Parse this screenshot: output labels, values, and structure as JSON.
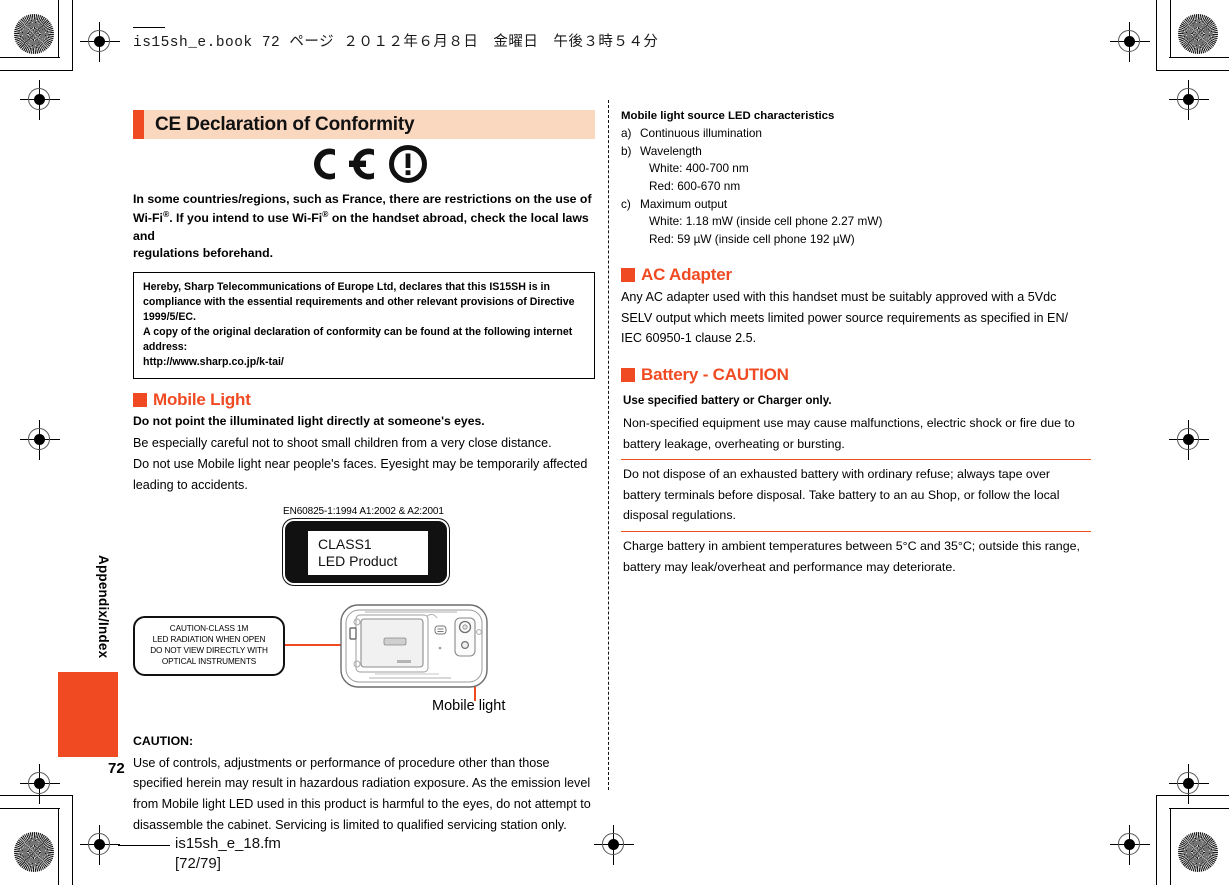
{
  "runhead": "is15sh_e.book  72 ページ  ２０１２年６月８日　金曜日　午後３時５４分",
  "sidebar": {
    "tab_label": "Appendix/Index",
    "page_number": "72",
    "accent_color": "#f04a23"
  },
  "footer": {
    "file_name": "is15sh_e_18.fm",
    "page_range": "[72/79]"
  },
  "left": {
    "banner_title": "CE Declaration of Conformity",
    "ce_marks": [
      "CE",
      "alert-exclamation"
    ],
    "wifi_note_line1": "In some countries/regions, such as France, there are restrictions on the use of",
    "wifi_note_line2_a": "Wi-Fi",
    "wifi_note_line2_sup": "®",
    "wifi_note_line2_b": ". If you intend to use Wi-Fi",
    "wifi_note_line2_sup2": "®",
    "wifi_note_line2_c": " on the handset abroad, check the local laws and",
    "wifi_note_line3": "regulations beforehand.",
    "declaration_box": [
      "Hereby, Sharp Telecommunications of Europe Ltd, declares that this IS15SH is in",
      "compliance with the essential requirements and other relevant provisions of Directive",
      "1999/5/EC.",
      "A copy of the original declaration of conformity can be found at the following internet",
      "address:",
      "http://www.sharp.co.jp/k-tai/"
    ],
    "mobile_light_heading": "Mobile Light",
    "mobile_light_lead": "Do not point the illuminated light directly at someone's eyes.",
    "mobile_light_p1": "Be especially careful not to shoot small children from a very close distance.",
    "mobile_light_p2": "Do not use Mobile light near people's faces. Eyesight may be temporarily affected",
    "mobile_light_p3": "leading to accidents.",
    "figure": {
      "en_standard": "EN60825-1:1994  A1:2002 & A2:2001",
      "class_plate_line1": "CLASS1",
      "class_plate_line2": "LED Product",
      "caution_plate": [
        "CAUTION-CLASS 1M",
        "LED RADIATION WHEN OPEN",
        "DO NOT VIEW DIRECTLY WITH",
        "OPTICAL INSTRUMENTS"
      ],
      "callout_label": "Mobile light"
    },
    "caution_title": "CAUTION:",
    "caution_p1": "Use of controls, adjustments or performance of procedure other than those",
    "caution_p2": "specified herein may result in hazardous radiation exposure. As the emission level",
    "caution_p3": "from Mobile light LED used in this product is harmful to the eyes, do not attempt to",
    "caution_p4": "disassemble the cabinet. Servicing is limited to qualified servicing station only."
  },
  "right": {
    "led_char_title": "Mobile light source LED characteristics",
    "led_items": [
      {
        "marker": "a)",
        "text": "Continuous illumination",
        "sub": []
      },
      {
        "marker": "b)",
        "text": "Wavelength",
        "sub": [
          "White: 400-700 nm",
          "Red: 600-670 nm"
        ]
      },
      {
        "marker": "c)",
        "text": "Maximum output",
        "sub": [
          "White: 1.18 mW (inside cell phone 2.27 mW)",
          "Red: 59 µW (inside cell phone 192 µW)"
        ]
      }
    ],
    "ac_adapter_heading": "AC Adapter",
    "ac_adapter_p1": "Any AC adapter used with this handset must be suitably approved with a 5Vdc",
    "ac_adapter_p2": "SELV output which meets limited power source requirements as specified in EN/",
    "ac_adapter_p3": "IEC 60950-1 clause 2.5.",
    "battery_heading": "Battery - CAUTION",
    "battery_lead": "Use specified battery or Charger only.",
    "battery_rows": [
      "Non-specified equipment use may cause malfunctions, electric shock or fire due to battery leakage, overheating or bursting.",
      "Do not dispose of an exhausted battery with ordinary refuse; always tape over battery terminals before disposal. Take battery to an au Shop, or follow the local disposal regulations.",
      "Charge battery in ambient temperatures between 5°C and 35°C; outside this range, battery may leak/overheat and performance may deteriorate."
    ]
  }
}
